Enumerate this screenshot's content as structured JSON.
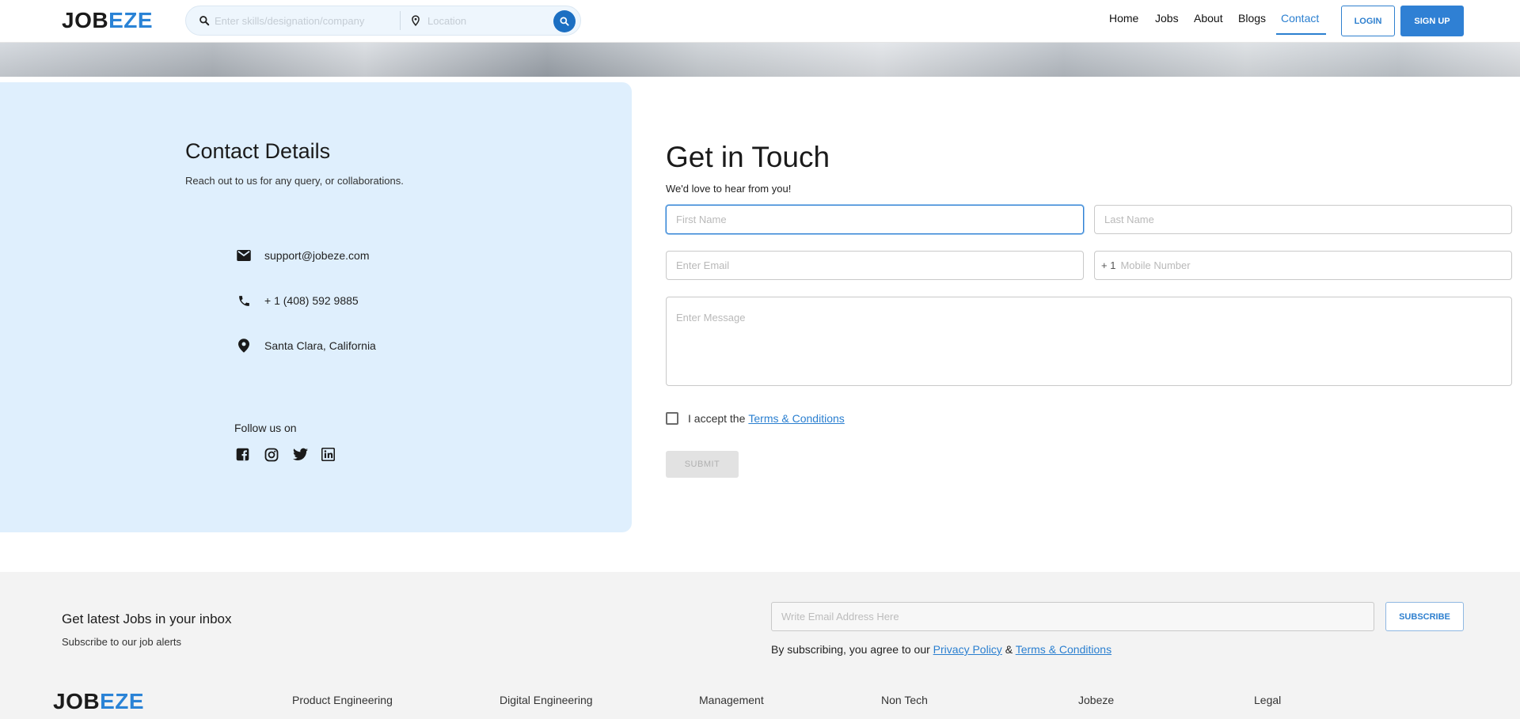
{
  "brand": {
    "logo_part1": "JOB",
    "logo_part2": "EZE",
    "accent": "#2a83d6",
    "primary": "#2f80d4"
  },
  "header": {
    "search": {
      "keyword_placeholder": "Enter skills/designation/company",
      "location_placeholder": "Location",
      "search_icon": "search-icon",
      "location_icon": "map-pin-icon"
    },
    "nav": [
      "Home",
      "Jobs",
      "About",
      "Blogs",
      "Contact"
    ],
    "active_nav": "Contact",
    "login_label": "LOGIN",
    "signup_label": "SIGN UP"
  },
  "contact": {
    "title": "Contact Details",
    "subtitle": "Reach out to us for any query, or collaborations.",
    "email": "support@jobeze.com",
    "phone": "+ 1 (408) 592 9885",
    "location": "Santa Clara, California",
    "follow_label": "Follow us on",
    "social_icons": [
      "facebook-icon",
      "instagram-icon",
      "twitter-icon",
      "linkedin-icon"
    ]
  },
  "form": {
    "title": "Get in Touch",
    "subtitle": "We'd love to hear from you!",
    "first_name_placeholder": "First Name",
    "last_name_placeholder": "Last Name",
    "email_placeholder": "Enter Email",
    "country_code": "+ 1",
    "mobile_placeholder": "Mobile Number",
    "message_placeholder": "Enter Message",
    "terms_prefix": "I accept the",
    "terms_link": "Terms & Conditions",
    "submit_label": "SUBMIT"
  },
  "footer": {
    "newsletter_title": "Get latest Jobs in your inbox",
    "newsletter_subtitle": "Subscribe to our job alerts",
    "email_placeholder": "Write Email Address Here",
    "subscribe_label": "SUBSCRIBE",
    "agree_prefix": "By subscribing, you agree to our",
    "privacy_link": "Privacy Policy",
    "agree_and": "&",
    "terms_link": "Terms & Conditions",
    "columns": [
      "Product Engineering",
      "Digital Engineering",
      "Management",
      "Non Tech",
      "Jobeze",
      "Legal"
    ]
  }
}
